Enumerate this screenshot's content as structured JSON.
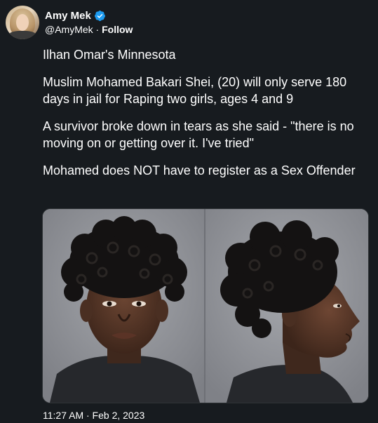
{
  "author": {
    "name": "Amy Mek",
    "handle": "@AmyMek",
    "separator": " · ",
    "follow_label": "Follow",
    "verified_color": "#1d9bf0"
  },
  "tweet": {
    "paragraphs": [
      "Ilhan Omar's Minnesota",
      "Muslim Mohamed Bakari Shei, (20) will only serve 180 days in jail for Raping two girls, ages 4 and 9",
      "A survivor broke down in tears as she said - \"there is no moving on or getting over it. I've tried\"",
      "Mohamed does NOT have to register as a Sex Offender"
    ],
    "timestamp": "11:27 AM · Feb 2, 2023"
  },
  "media": {
    "panels": [
      "front-view-mugshot",
      "profile-view-mugshot"
    ]
  }
}
